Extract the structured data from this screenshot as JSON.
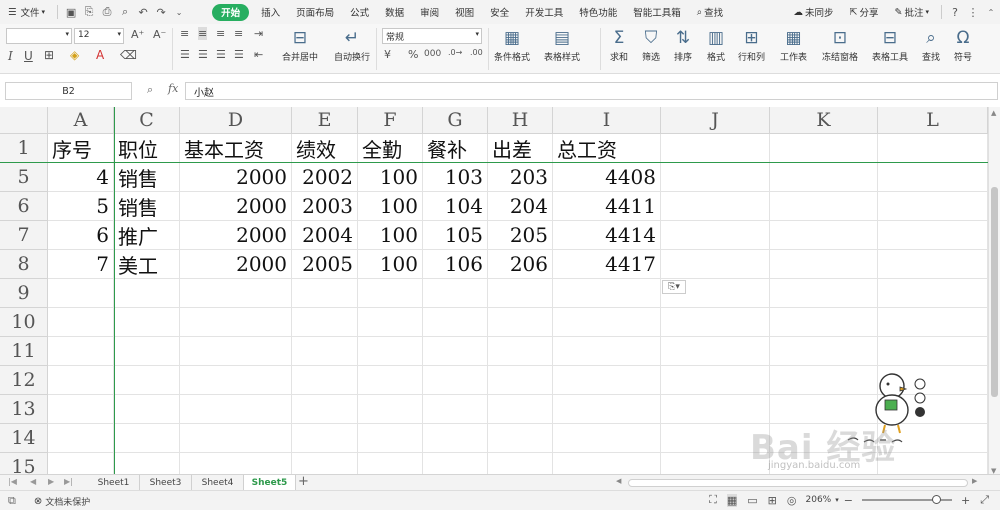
{
  "menubar": {
    "file_label": "文件",
    "tabs": [
      "开始",
      "插入",
      "页面布局",
      "公式",
      "数据",
      "审阅",
      "视图",
      "安全",
      "开发工具",
      "特色功能",
      "智能工具箱"
    ],
    "active_tab": "开始",
    "search_label": "查找",
    "sync_label": "未同步",
    "share_label": "分享",
    "comment_label": "批注"
  },
  "ribbon": {
    "font_size": "12",
    "number_format": "常规",
    "buttons": {
      "merge_center": "合并居中",
      "wrap_text": "自动换行",
      "conditional_format": "条件格式",
      "table_style": "表格样式",
      "sum": "求和",
      "filter": "筛选",
      "sort": "排序",
      "format": "格式",
      "row_col": "行和列",
      "worksheet": "工作表",
      "freeze": "冻结窗格",
      "table_tools": "表格工具",
      "find": "查找",
      "symbol": "符号"
    }
  },
  "formula_bar": {
    "name_box": "B2",
    "fx_label": "fx",
    "content": "小赵"
  },
  "grid": {
    "columns": [
      "A",
      "C",
      "D",
      "E",
      "F",
      "G",
      "H",
      "I",
      "J",
      "K",
      "L"
    ],
    "row_numbers": [
      "1",
      "5",
      "6",
      "7",
      "8",
      "9",
      "10",
      "11",
      "12",
      "13",
      "14",
      "15"
    ],
    "header_row": [
      "序号",
      "职位",
      "基本工资",
      "绩效",
      "全勤",
      "餐补",
      "出差",
      "总工资"
    ],
    "rows": [
      [
        "4",
        "销售",
        "2000",
        "2002",
        "100",
        "103",
        "203",
        "4408"
      ],
      [
        "5",
        "销售",
        "2000",
        "2003",
        "100",
        "104",
        "204",
        "4411"
      ],
      [
        "6",
        "推广",
        "2000",
        "2004",
        "100",
        "105",
        "205",
        "4414"
      ],
      [
        "7",
        "美工",
        "2000",
        "2005",
        "100",
        "106",
        "206",
        "4417"
      ]
    ]
  },
  "sheets": {
    "tabs": [
      "Sheet1",
      "Sheet3",
      "Sheet4",
      "Sheet5"
    ],
    "active": "Sheet5"
  },
  "status": {
    "protection_label": "文档未保护",
    "zoom": "206%"
  },
  "watermark": {
    "brand": "Bai 经验",
    "url": "jingyan.baidu.com"
  },
  "colors": {
    "accent": "#27ae60",
    "freeze_line": "#2e9a4c",
    "header_bg": "#f3f3f3"
  }
}
